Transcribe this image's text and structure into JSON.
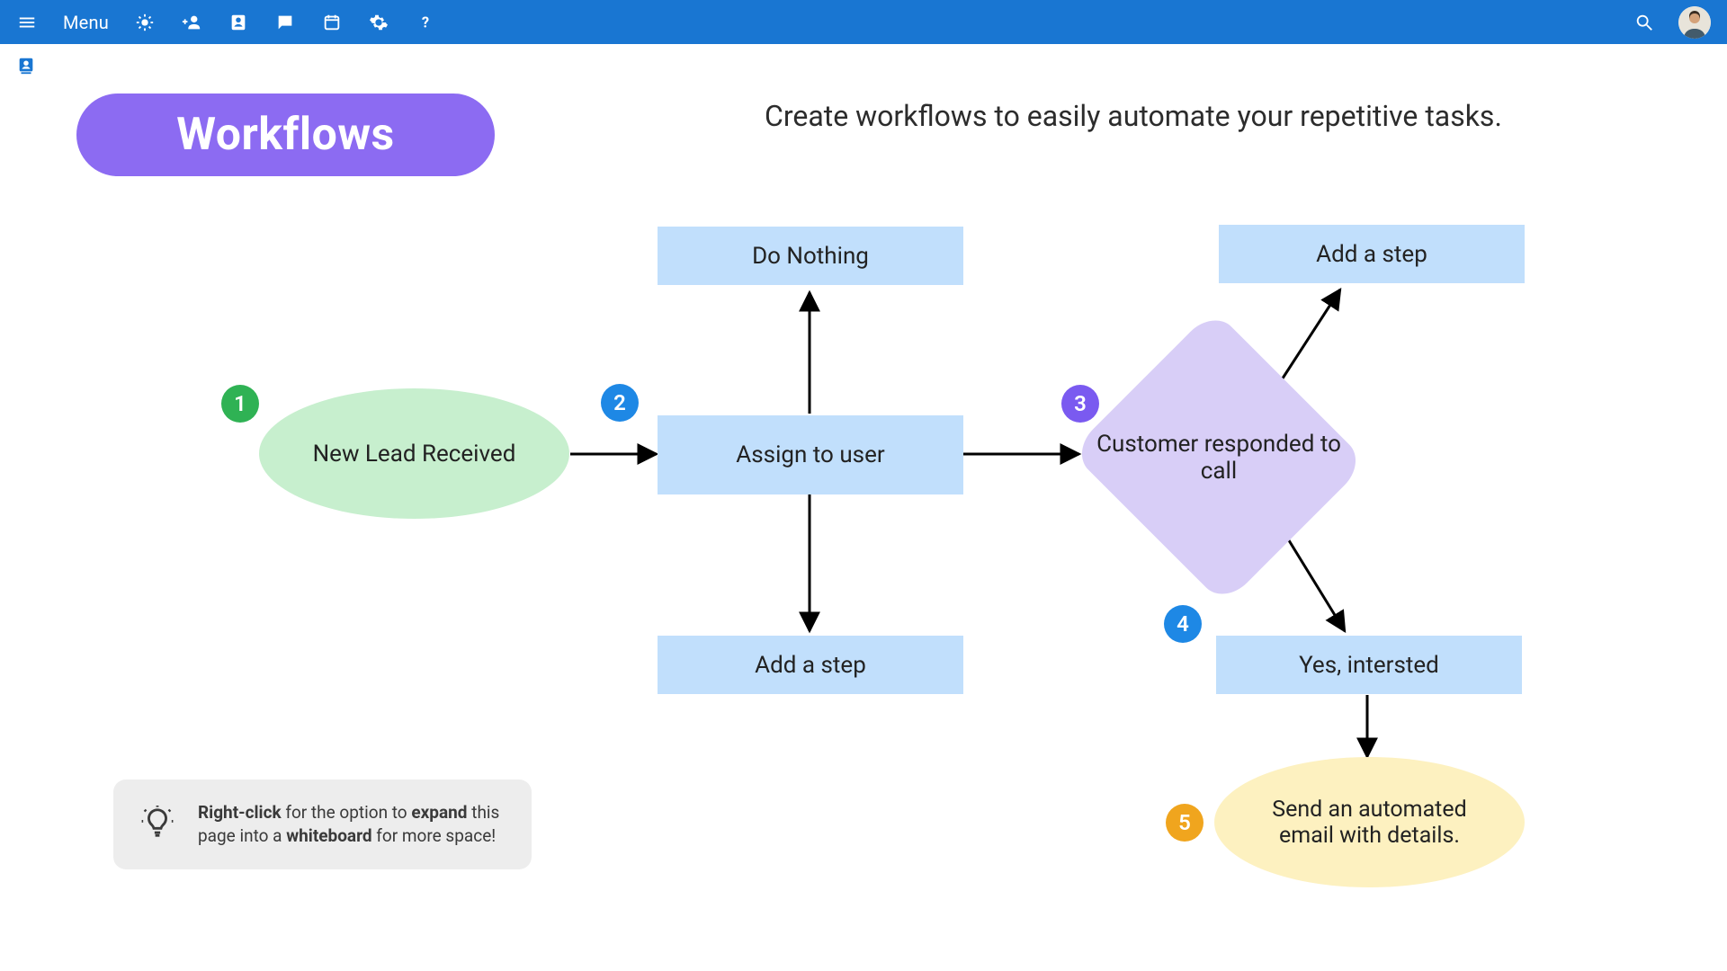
{
  "topbar": {
    "menu_label": "Menu"
  },
  "page": {
    "title": "Workflows",
    "subtitle": "Create workflows to easily automate your repetitive tasks."
  },
  "badges": {
    "b1": "1",
    "b2": "2",
    "b3": "3",
    "b4": "4",
    "b5": "5"
  },
  "nodes": {
    "start": "New Lead Received",
    "assign": "Assign to user",
    "do_nothing": "Do Nothing",
    "add_step_below": "Add a step",
    "decision": "Customer responded to call",
    "add_step_top": "Add a step",
    "yes": "Yes, intersted",
    "end": "Send an automated email with details."
  },
  "colors": {
    "topbar": "#1976d2",
    "pill": "#8c6bf2",
    "ellipse_start": "#c7efce",
    "ellipse_end": "#fdf1c0",
    "rect": "#c1dffc",
    "diamond": "#d8cef7",
    "badge_green": "#2fb254",
    "badge_blue": "#1e88e5",
    "badge_purple": "#7a5af0",
    "badge_orange": "#f0a51e"
  },
  "tip": {
    "part1": "Right-click",
    "part2": " for the option to ",
    "part3": "expand",
    "part4": " this page into a ",
    "part5": "whiteboard",
    "part6": " for more space!"
  }
}
